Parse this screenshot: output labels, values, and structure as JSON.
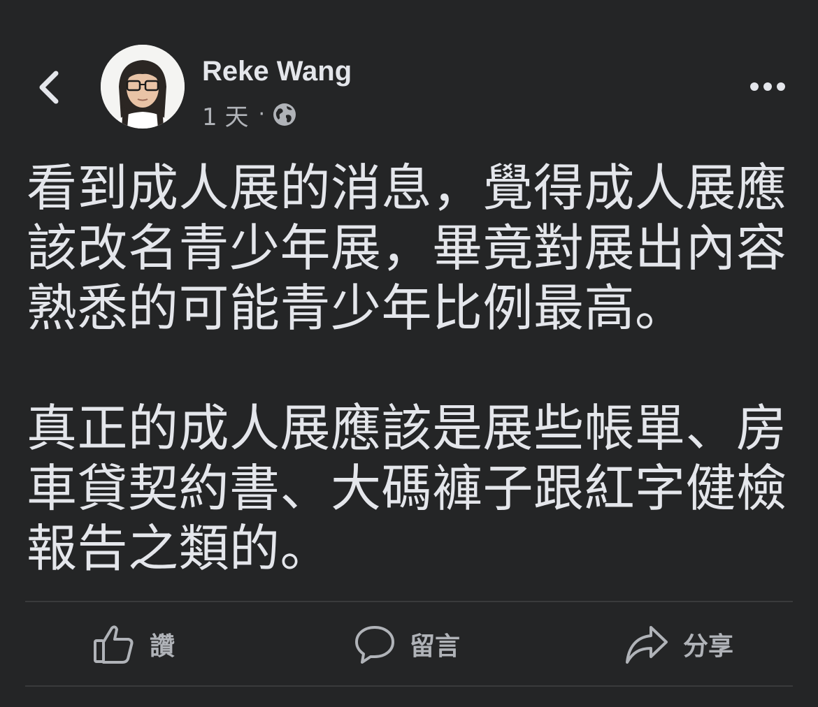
{
  "post": {
    "author": "Reke Wang",
    "time": "1 天",
    "separator": "·",
    "privacy_icon": "globe-icon",
    "paragraphs": [
      "看到成人展的消息，覺得成人展應該改名青少年展，畢竟對展出內容熟悉的可能青少年比例最高。",
      "真正的成人展應該是展些帳單、房車貸契約書、大碼褲子跟紅字健檢報告之類的。"
    ]
  },
  "actions": {
    "like": "讚",
    "comment": "留言",
    "share": "分享"
  },
  "icons": {
    "back": "chevron-left-icon",
    "more": "more-horizontal-icon",
    "like": "thumbs-up-icon",
    "comment": "comment-bubble-icon",
    "share": "share-arrow-icon"
  },
  "colors": {
    "background": "#242526",
    "text_primary": "#e4e6eb",
    "text_secondary": "#b0b3b8",
    "divider": "#3a3b3c"
  }
}
